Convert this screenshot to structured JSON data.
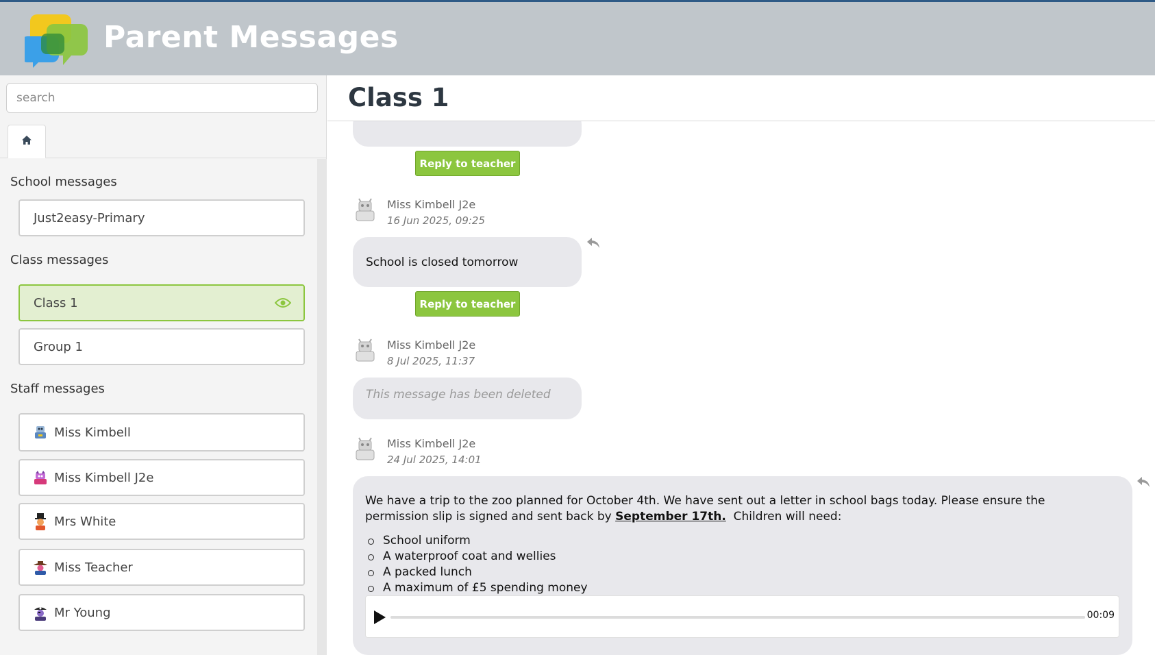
{
  "app": {
    "title": "Parent Messages"
  },
  "sidebar": {
    "search_placeholder": "search",
    "home_tab": "home-icon",
    "sections": {
      "school": "School messages",
      "class": "Class messages",
      "staff": "Staff messages"
    },
    "school_items": [
      {
        "label": "Just2easy-Primary"
      }
    ],
    "class_items": [
      {
        "label": "Class 1",
        "active": true,
        "icon": "eye-icon"
      },
      {
        "label": "Group 1",
        "active": false
      }
    ],
    "staff_items": [
      {
        "label": "Miss Kimbell",
        "icon": "robot-avatar-icon"
      },
      {
        "label": "Miss Kimbell J2e",
        "icon": "monster-avatar-icon"
      },
      {
        "label": "Mrs White",
        "icon": "top-hat-avatar-icon"
      },
      {
        "label": "Miss Teacher",
        "icon": "cowboy-avatar-icon"
      },
      {
        "label": "Mr Young",
        "icon": "pirate-avatar-icon"
      }
    ]
  },
  "main": {
    "title": "Class 1",
    "reply_label": "Reply to teacher",
    "messages": [
      {
        "sender": "Miss Kimbell J2e",
        "time": "16 Jun 2025, 09:25",
        "text": "School is closed tomorrow"
      },
      {
        "sender": "Miss Kimbell J2e",
        "time": "8 Jul 2025, 11:37",
        "text": "This message has been deleted"
      },
      {
        "sender": "Miss Kimbell J2e",
        "time": "24 Jul 2025, 14:01",
        "text_before": "We have a trip to the zoo planned for October 4th. We have sent out a letter in school bags today. Please ensure the permission slip is signed and sent back by ",
        "text_bold": "September 17th.",
        "text_after": "  Children will need:",
        "list": [
          "School uniform",
          "A waterproof coat and wellies",
          "A packed lunch",
          "A maximum of £5 spending money"
        ],
        "audio_time": "00:09"
      }
    ]
  },
  "colors": {
    "accent_green": "#8cc63f",
    "header_bg": "#c0c6cb",
    "bubble_bg": "#e8e8ec"
  }
}
